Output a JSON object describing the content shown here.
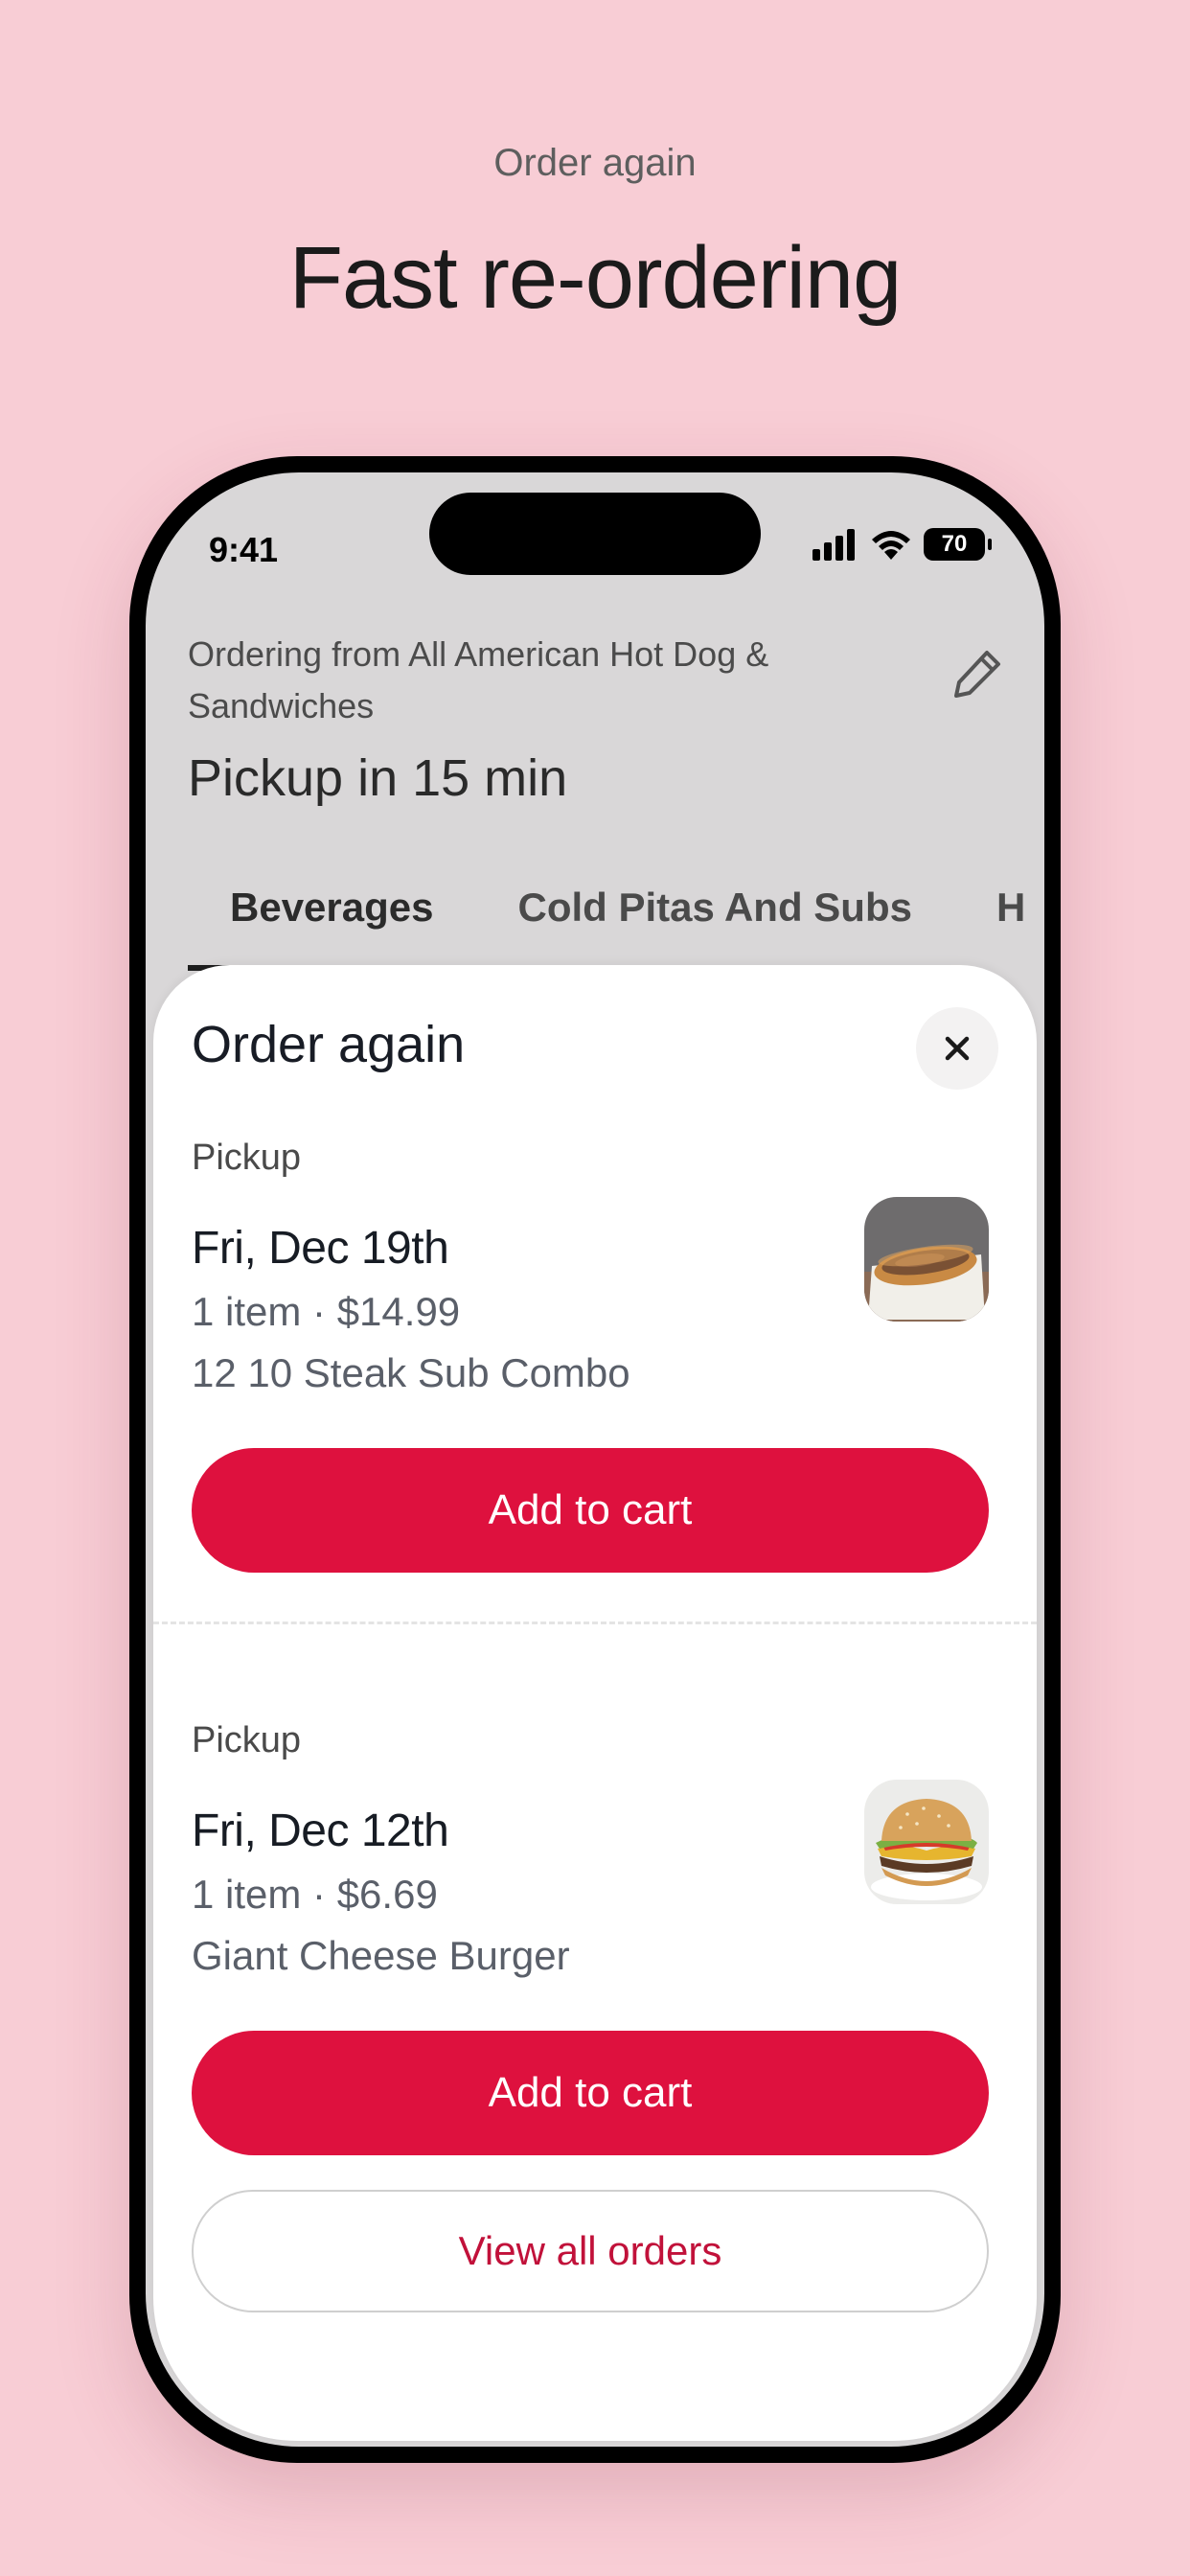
{
  "hero": {
    "eyebrow": "Order again",
    "title": "Fast re-ordering"
  },
  "status_bar": {
    "time": "9:41",
    "battery": "70",
    "icons": [
      "signal-icon",
      "wifi-icon",
      "battery-icon"
    ]
  },
  "store": {
    "ordering_from": "Ordering from All American Hot Dog & Sandwiches",
    "pickup_eta": "Pickup in 15 min",
    "edit_icon": "pencil-icon"
  },
  "tabs": [
    {
      "label": "Beverages",
      "active": true
    },
    {
      "label": "Cold Pitas And Subs",
      "active": false
    },
    {
      "label": "H",
      "active": false
    }
  ],
  "sheet": {
    "title": "Order again",
    "close_icon": "close-icon",
    "orders": [
      {
        "type": "Pickup",
        "date": "Fri, Dec 19th",
        "summary": "1 item · $14.99",
        "item": "12 10 Steak Sub Combo",
        "thumb_icon": "steak-sub-image",
        "cta": "Add to cart"
      },
      {
        "type": "Pickup",
        "date": "Fri, Dec 12th",
        "summary": "1 item · $6.69",
        "item": "Giant Cheese Burger",
        "thumb_icon": "cheeseburger-image",
        "cta": "Add to cart"
      }
    ],
    "view_all": "View all orders"
  },
  "colors": {
    "background": "#f8cdd5",
    "accent": "#de113e",
    "link": "#c1113a"
  }
}
